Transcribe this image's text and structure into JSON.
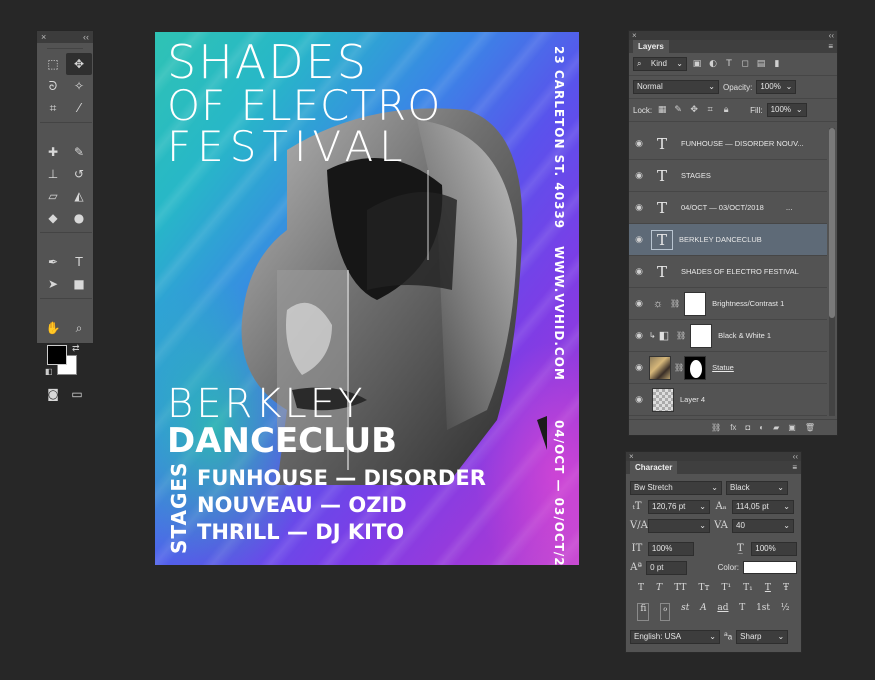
{
  "tools_panel": {
    "close_glyph": "×",
    "collapse_glyph": "‹‹",
    "tools": [
      {
        "icon": "marquee-icon",
        "glyph": "⬚"
      },
      {
        "icon": "move-icon",
        "glyph": "✥"
      },
      {
        "icon": "lasso-icon",
        "glyph": "ᘐ"
      },
      {
        "icon": "magic-wand-icon",
        "glyph": "✧"
      },
      {
        "icon": "crop-icon",
        "glyph": "⌗"
      },
      {
        "icon": "eyedropper-icon",
        "glyph": "⁄"
      },
      {
        "icon": "healing-brush-icon",
        "glyph": "✚"
      },
      {
        "icon": "brush-icon",
        "glyph": "✎"
      },
      {
        "icon": "clone-stamp-icon",
        "glyph": "⊥"
      },
      {
        "icon": "history-brush-icon",
        "glyph": "↺"
      },
      {
        "icon": "eraser-icon",
        "glyph": "▱"
      },
      {
        "icon": "paint-bucket-icon",
        "glyph": "◭"
      },
      {
        "icon": "blur-icon",
        "glyph": "◆"
      },
      {
        "icon": "dodge-icon",
        "glyph": "●"
      },
      {
        "icon": "pen-icon",
        "glyph": "✒"
      },
      {
        "icon": "type-icon",
        "glyph": "T"
      },
      {
        "icon": "path-selection-icon",
        "glyph": "➤"
      },
      {
        "icon": "rectangle-icon",
        "glyph": "■"
      },
      {
        "icon": "hand-icon",
        "glyph": "✋"
      },
      {
        "icon": "zoom-icon",
        "glyph": "⌕"
      }
    ],
    "quick_mask_glyph": "◙",
    "screen_mode_glyph": "▭"
  },
  "poster": {
    "title_line1": "SHADES",
    "title_line2": "OF ELECTRO",
    "title_line3": "FESTIVAL",
    "address": "23 CARLETON ST. 40339",
    "website": "WWW.VVHID.COM",
    "dates": "04/OCT — 03/OCT/2018",
    "club_line1": "BERKLEY",
    "club_line2": "DANCECLUB",
    "stages_label": "STAGES",
    "stage_lines": [
      "FUNHOUSE — DISORDER",
      "NOUVEAU — OZID",
      "THRILL — DJ KITO"
    ]
  },
  "layers_panel": {
    "title": "Layers",
    "close_glyph": "×",
    "collapse_glyph": "‹‹",
    "menu_glyph": "≡",
    "filter_kind": "Kind",
    "blend_mode": "Normal",
    "opacity_label": "Opacity:",
    "opacity_value": "100%",
    "lock_label": "Lock:",
    "fill_label": "Fill:",
    "fill_value": "100%",
    "layers": [
      {
        "name": "FUNHOUSE — DISORDER NOUV...",
        "kind": "text",
        "selected": false
      },
      {
        "name": "STAGES",
        "kind": "text",
        "selected": false
      },
      {
        "name": "04/OCT — 03/OCT/2018",
        "kind": "text",
        "selected": false,
        "suffix": "..."
      },
      {
        "name": "BERKLEY DANCECLUB",
        "kind": "text",
        "selected": true
      },
      {
        "name": "SHADES  OF ELECTRO FESTIVAL",
        "kind": "text",
        "selected": false
      },
      {
        "name": "Brightness/Contrast 1",
        "kind": "adjustment",
        "selected": false
      },
      {
        "name": "Black & White 1",
        "kind": "adjustment",
        "selected": false
      },
      {
        "name": "Statue",
        "kind": "image",
        "selected": false
      },
      {
        "name": "Layer 4",
        "kind": "pixel",
        "selected": false
      }
    ],
    "footer_icons": [
      "link-icon",
      "fx-icon",
      "mask-icon",
      "adjustment-icon",
      "folder-icon",
      "new-layer-icon",
      "trash-icon"
    ]
  },
  "character_panel": {
    "title": "Character",
    "close_glyph": "×",
    "collapse_glyph": "‹‹",
    "menu_glyph": "≡",
    "font_family": "Bw Stretch",
    "font_style": "Black",
    "font_size": "120,76 pt",
    "leading": "114,05 pt",
    "kerning": "",
    "tracking": "40",
    "vertical_scale": "100%",
    "horizontal_scale": "100%",
    "baseline_shift": "0 pt",
    "color_label": "Color:",
    "text_color": "#ffffff",
    "type_buttons": [
      "T",
      "T",
      "TT",
      "Tт",
      "T¹",
      "T₁",
      "T",
      "Ŧ"
    ],
    "opentype_buttons": [
      "fi",
      "ℴ",
      "st",
      "A",
      "ad",
      "T",
      "1st",
      "½"
    ],
    "language": "English: USA",
    "aa_label": "a",
    "antialias": "Sharp"
  }
}
